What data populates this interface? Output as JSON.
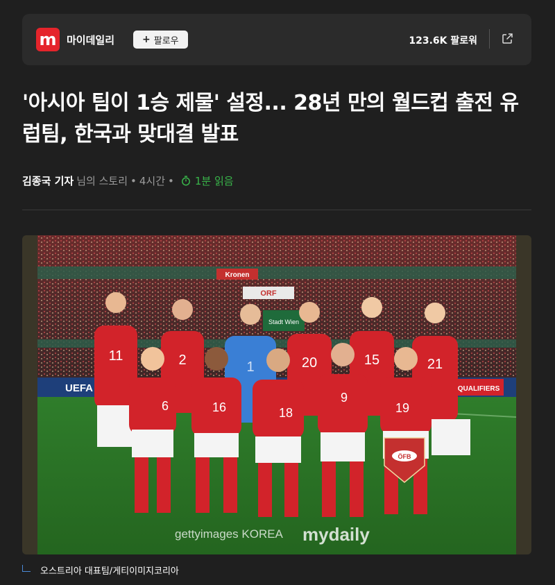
{
  "publisher": {
    "logo_letter": "m",
    "name": "마이데일리",
    "follow_label": "팔로우",
    "followers": "123.6K 팔로워"
  },
  "article": {
    "headline": "'아시아 팀이 1승 제물' 설정... 28년 만의 월드컵 출전 유럽팀, 한국과 맞대결 발표",
    "author": "김종국 기자",
    "story_suffix": "님의 스토리",
    "time": "4시간",
    "read_time": "1분 읽음"
  },
  "photo": {
    "watermark_getty": "gettyimages KOREA",
    "watermark_mydaily": "mydaily",
    "stadium_signs": [
      "UEFA",
      "QUALIFIERS",
      "Stadt Wien",
      "ORF",
      "Kronen"
    ],
    "jersey_numbers": [
      "11",
      "2",
      "1",
      "20",
      "15",
      "21",
      "6",
      "16",
      "18",
      "9",
      "19"
    ],
    "pennant_text": "ÖFB"
  },
  "caption": "오스트리아 대표팀/게티이미지코리아",
  "colors": {
    "background": "#1f1f1f",
    "card": "#2b2b2b",
    "brand_red": "#e5242b",
    "read_green": "#39b54a",
    "kit_red": "#d2232a",
    "keeper_blue": "#3a7fd5"
  }
}
